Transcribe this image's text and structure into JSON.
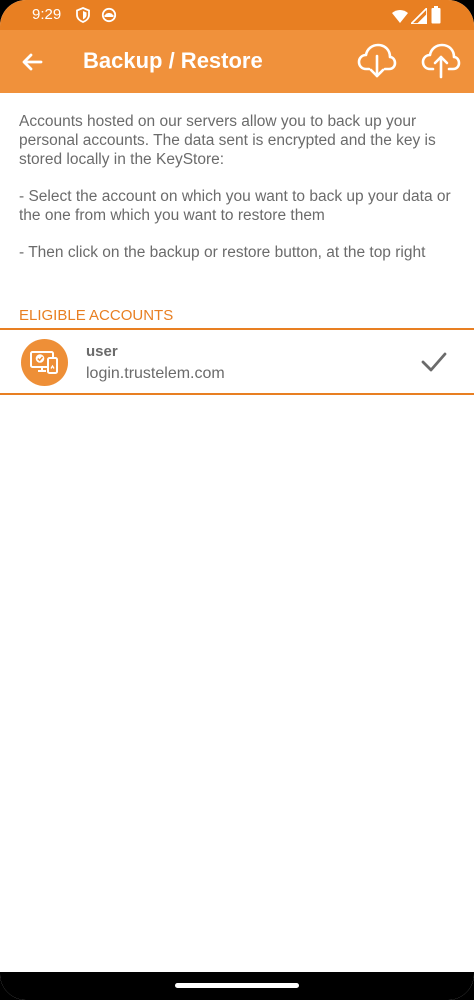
{
  "status_bar": {
    "time": "9:29",
    "icons": [
      "shield-icon",
      "circle-face-icon",
      "wifi-icon",
      "signal-icon",
      "battery-icon"
    ]
  },
  "app_bar": {
    "title": "Backup / Restore",
    "back_icon": "arrow-left-icon",
    "actions": [
      "cloud-download-icon",
      "cloud-upload-icon"
    ]
  },
  "intro": {
    "paragraph_1": "Accounts hosted on our servers allow you to back up your personal accounts. The data sent is encrypted and the key is stored locally in the KeyStore:",
    "paragraph_2": "- Select the account on which you want to back up your data or the one from which you want to restore them",
    "paragraph_3": "- Then click on the backup or restore button, at the top right"
  },
  "section": {
    "header": "ELIGIBLE ACCOUNTS"
  },
  "accounts": [
    {
      "name": "user",
      "host": "login.trustelem.com",
      "selected": true
    }
  ],
  "colors": {
    "accent": "#e87f22",
    "app_bar": "#f0913b",
    "text": "#6b6b6b"
  }
}
